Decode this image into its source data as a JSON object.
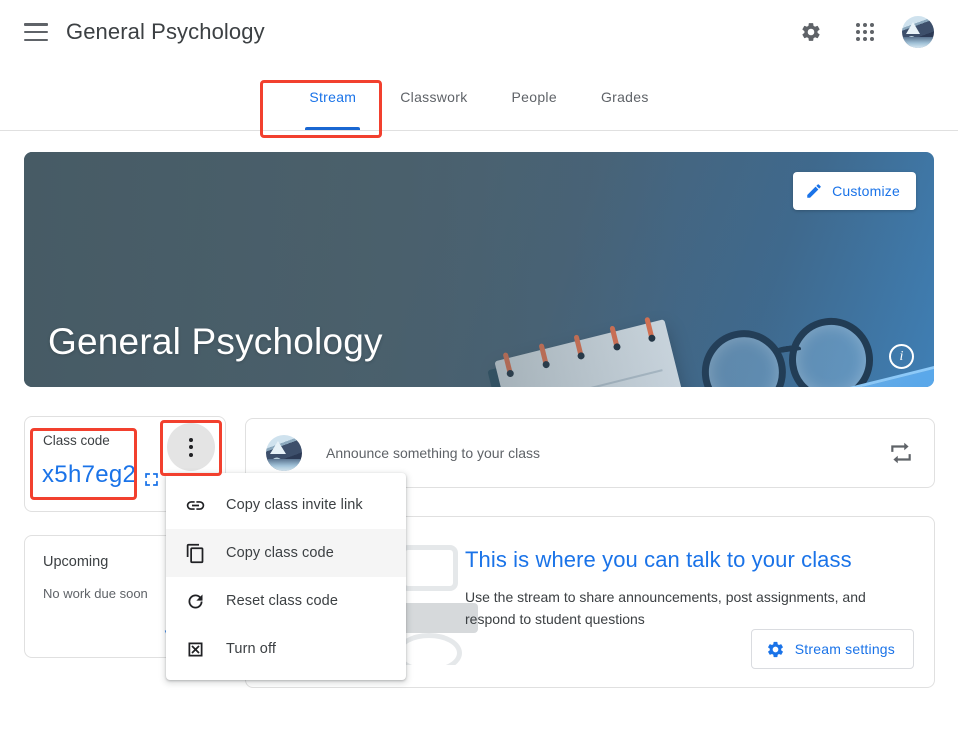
{
  "header": {
    "menu_icon": "hamburger-icon",
    "title": "General Psychology",
    "settings_icon": "gear-icon",
    "apps_icon": "apps-grid-icon",
    "account_icon": "account-avatar"
  },
  "tabs": [
    {
      "label": "Stream",
      "active": true
    },
    {
      "label": "Classwork",
      "active": false
    },
    {
      "label": "People",
      "active": false
    },
    {
      "label": "Grades",
      "active": false
    }
  ],
  "hero": {
    "title": "General Psychology",
    "customize_label": "Customize",
    "customize_icon": "pencil-icon",
    "info_icon": "info-icon",
    "background_color": "#4f6775",
    "accent_color": "#3f7fb5"
  },
  "class_code": {
    "label": "Class code",
    "code": "x5h7eg2",
    "expand_icon": "fullscreen-expand-icon",
    "more_icon": "more-vert-icon",
    "code_color": "#1a73e8"
  },
  "upcoming": {
    "title": "Upcoming",
    "empty_text": "No work due soon",
    "link_label": "View all"
  },
  "announcement": {
    "avatar_icon": "user-avatar",
    "placeholder": "Announce something to your class",
    "reuse_icon": "reuse-post-icon"
  },
  "stream_empty": {
    "title": "This is where you can talk to your class",
    "body": "Use the stream to share announcements, post assignments, and respond to student questions",
    "button_label": "Stream settings",
    "button_icon": "gear-icon"
  },
  "context_menu": {
    "items": [
      {
        "label": "Copy class invite link",
        "icon": "link-icon",
        "hover": false
      },
      {
        "label": "Copy class code",
        "icon": "copy-icon",
        "hover": true
      },
      {
        "label": "Reset class code",
        "icon": "refresh-icon",
        "hover": false
      },
      {
        "label": "Turn off",
        "icon": "disable-box-icon",
        "hover": false
      }
    ]
  },
  "annotations": {
    "highlight_color": "#f2402e",
    "boxes": [
      "stream-tab",
      "class-code",
      "more-options-button"
    ]
  }
}
